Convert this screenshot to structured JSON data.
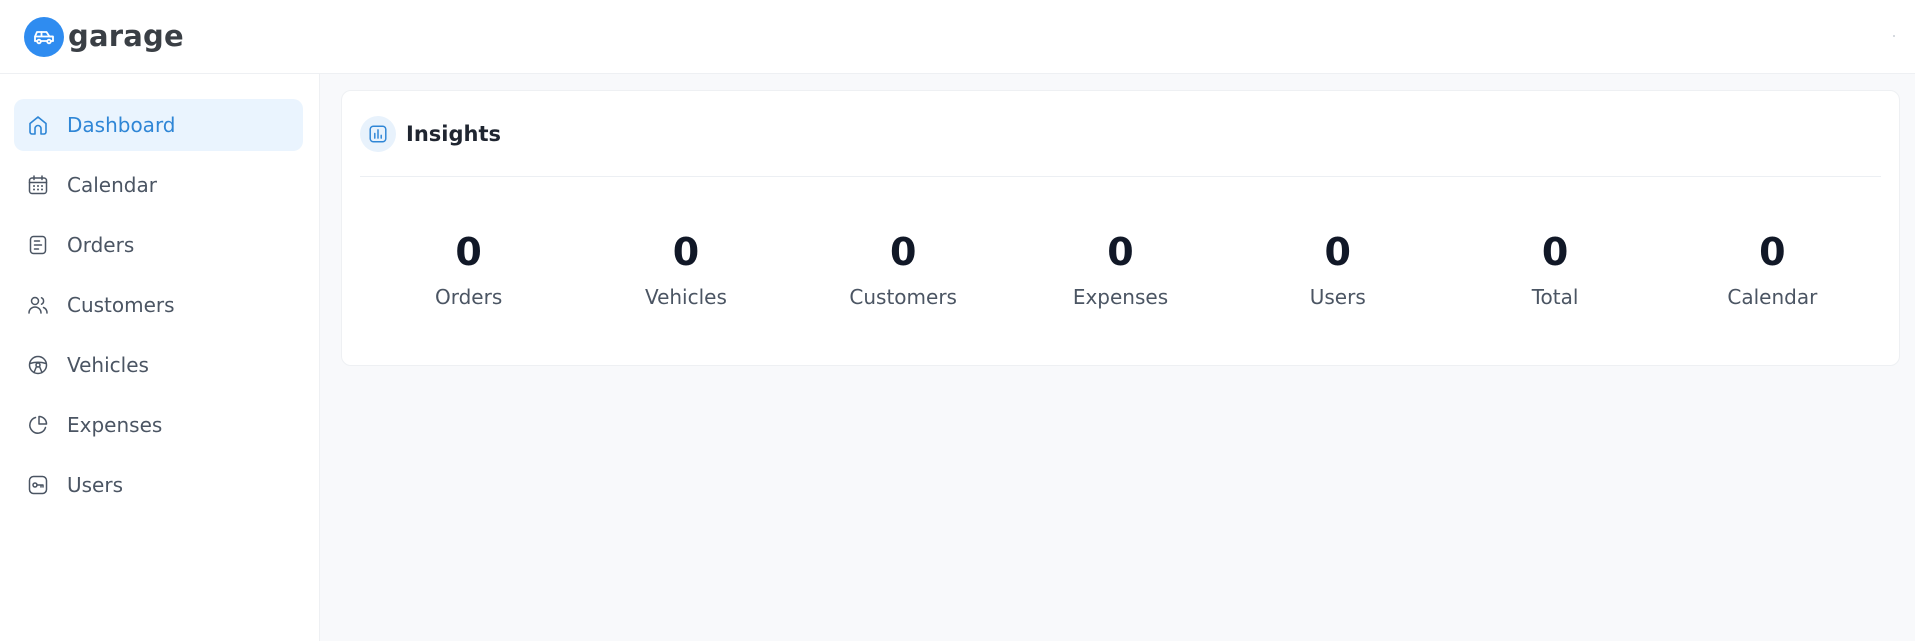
{
  "app": {
    "name": "garage",
    "brand_color": "#2f8cf0",
    "logo_icon": "car-icon"
  },
  "sidebar": {
    "items": [
      {
        "label": "Dashboard",
        "icon": "home-icon",
        "active": true
      },
      {
        "label": "Calendar",
        "icon": "calendar-icon",
        "active": false
      },
      {
        "label": "Orders",
        "icon": "document-icon",
        "active": false
      },
      {
        "label": "Customers",
        "icon": "users-icon",
        "active": false
      },
      {
        "label": "Vehicles",
        "icon": "steering-wheel-icon",
        "active": false
      },
      {
        "label": "Expenses",
        "icon": "pie-chart-icon",
        "active": false
      },
      {
        "label": "Users",
        "icon": "key-icon",
        "active": false
      }
    ],
    "active_color": "#2f86d6",
    "active_background": "#eaf4fe"
  },
  "insights": {
    "title": "Insights",
    "icon": "bar-chart-icon",
    "stats": [
      {
        "value": "0",
        "label": "Orders"
      },
      {
        "value": "0",
        "label": "Vehicles"
      },
      {
        "value": "0",
        "label": "Customers"
      },
      {
        "value": "0",
        "label": "Expenses"
      },
      {
        "value": "0",
        "label": "Users"
      },
      {
        "value": "0",
        "label": "Total"
      },
      {
        "value": "0",
        "label": "Calendar"
      }
    ]
  }
}
